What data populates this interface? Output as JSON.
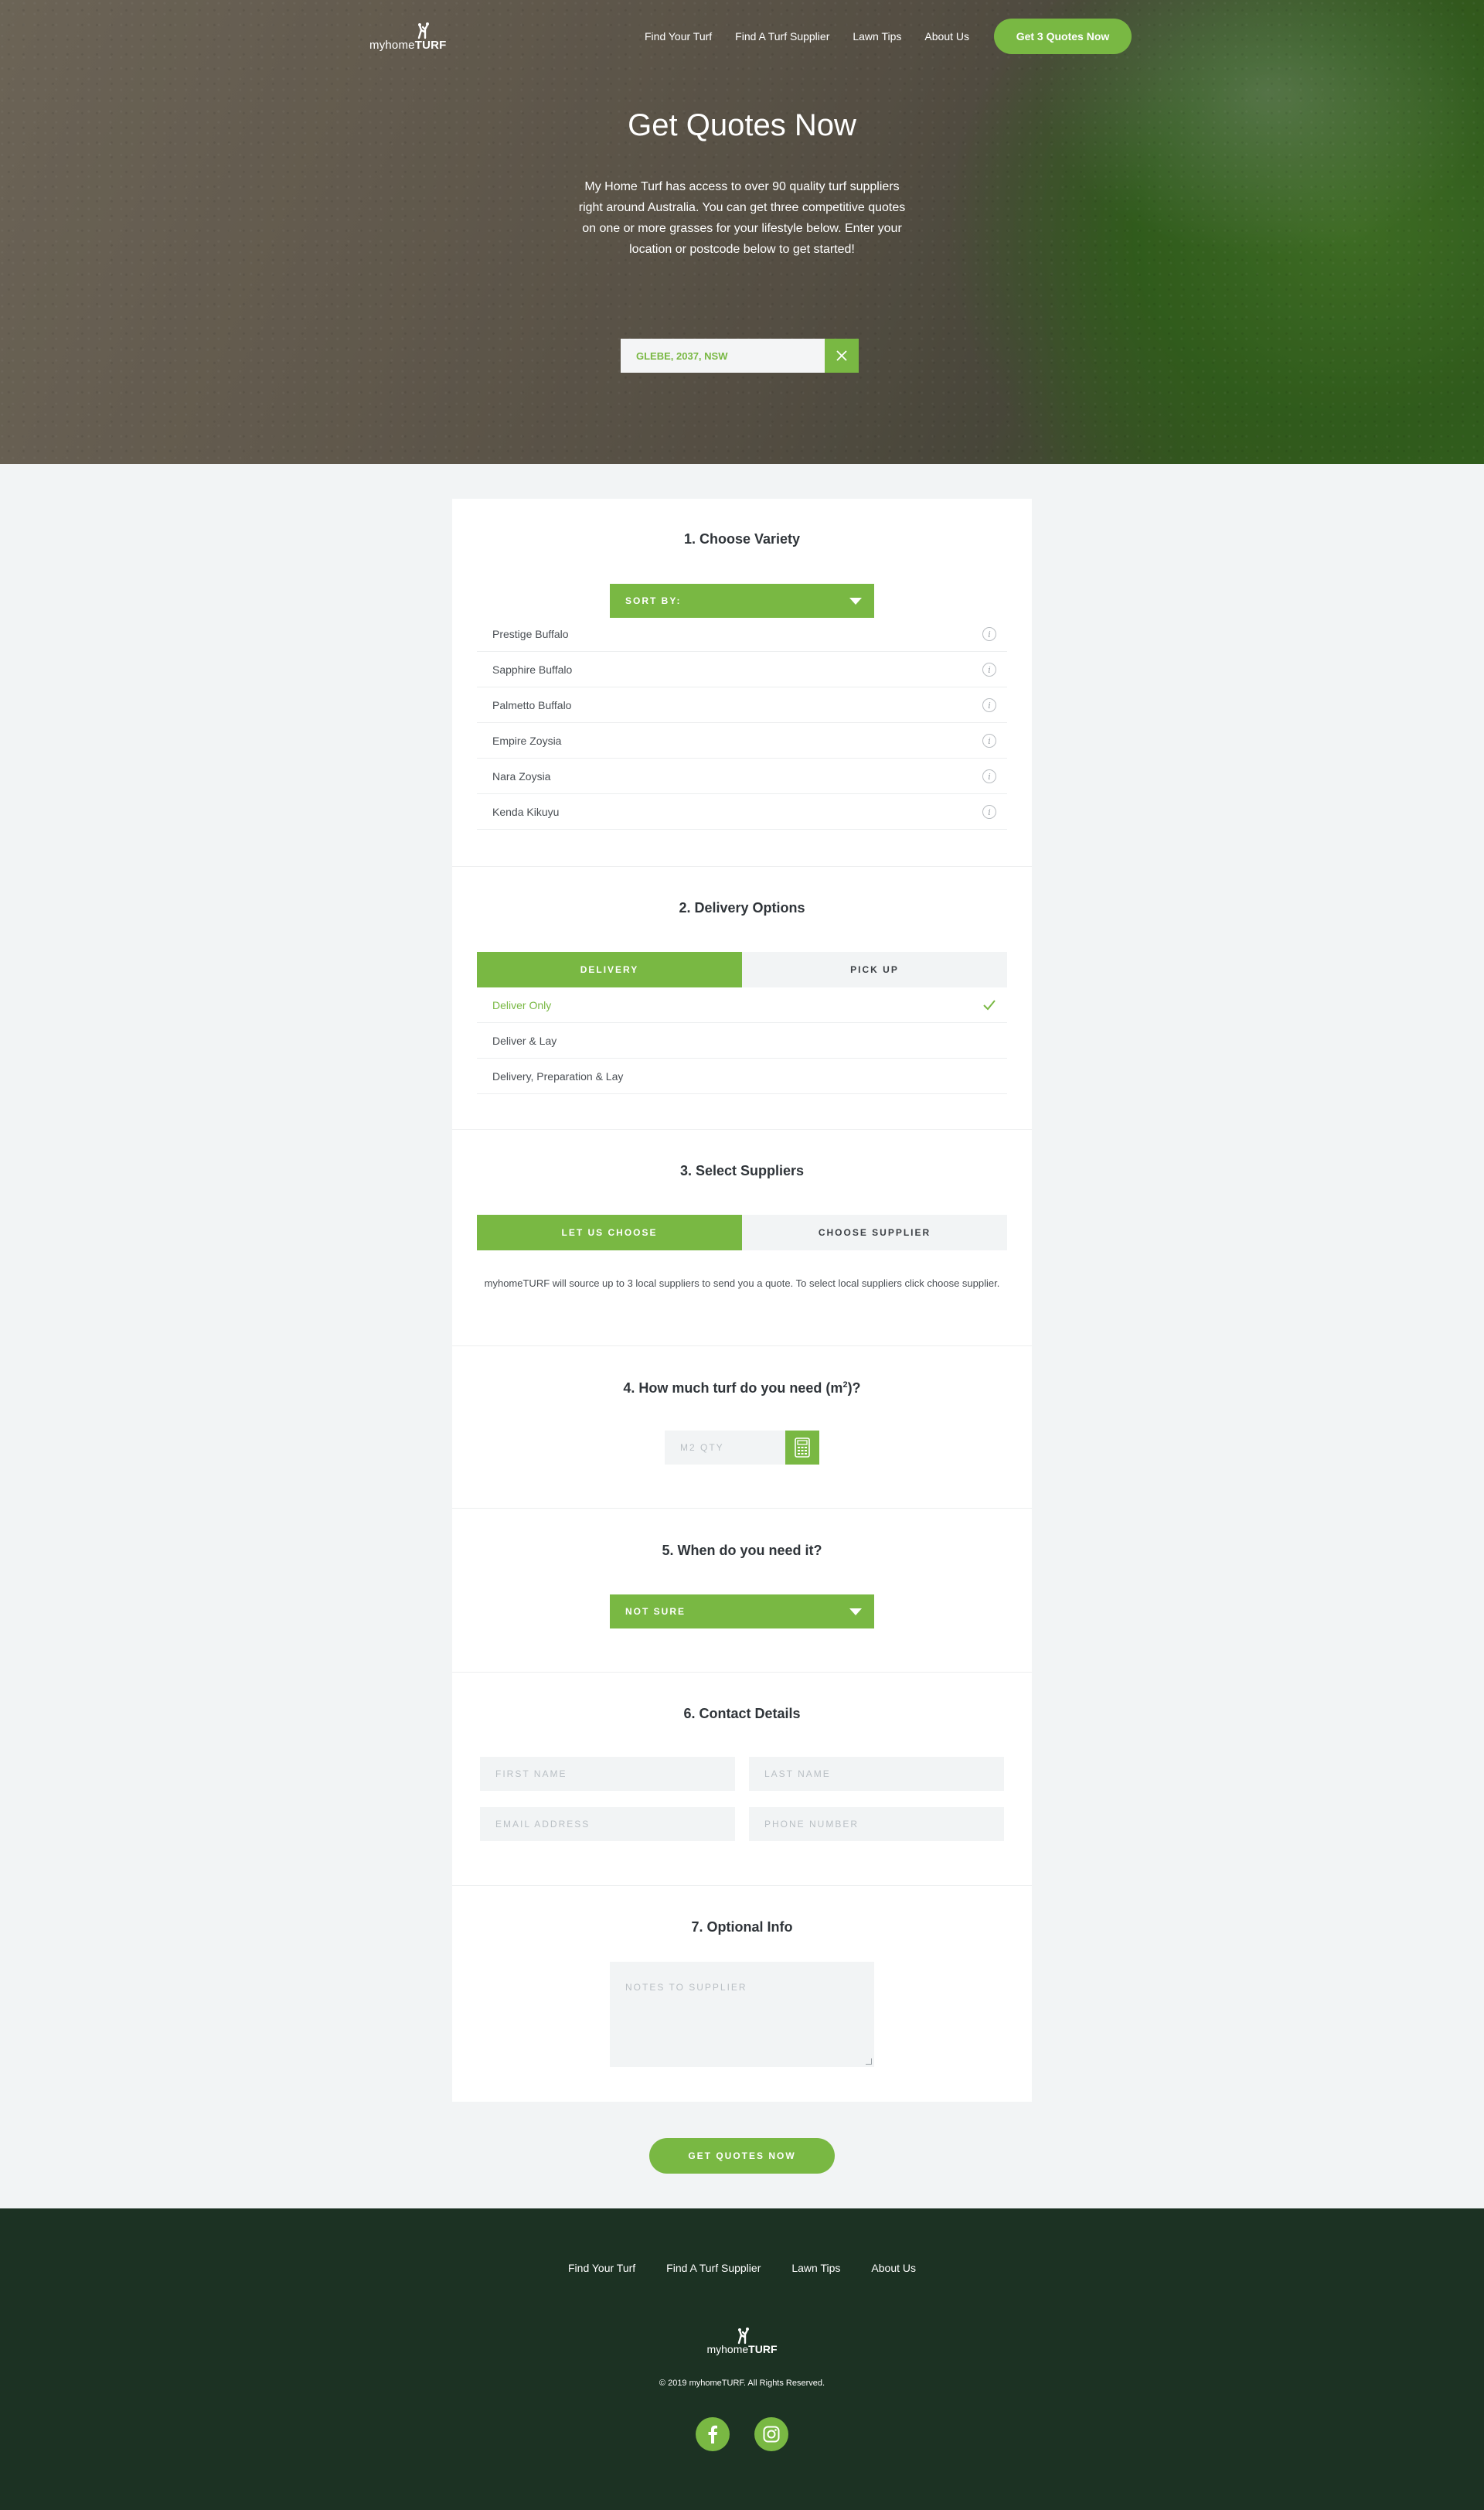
{
  "header": {
    "logo": {
      "prefix": "myhome",
      "suffix": "TURF"
    },
    "nav": [
      "Find Your Turf",
      "Find A Turf Supplier",
      "Lawn Tips",
      "About Us"
    ],
    "cta": "Get 3 Quotes Now"
  },
  "hero": {
    "title": "Get Quotes Now",
    "description": "My Home Turf has access to over 90 quality turf suppliers right around Australia. You can get three competitive quotes on one or more grasses for your lifestyle below. Enter your location or postcode below to get started!",
    "location_value": "GLEBE, 2037, NSW"
  },
  "step1": {
    "title": "1. Choose Variety",
    "sort_label": "SORT BY:",
    "varieties": [
      "Prestige Buffalo",
      "Sapphire Buffalo",
      "Palmetto Buffalo",
      "Empire Zoysia",
      "Nara Zoysia",
      "Kenda Kikuyu"
    ]
  },
  "step2": {
    "title": "2. Delivery Options",
    "tabs": [
      "DELIVERY",
      "PICK UP"
    ],
    "options": [
      "Deliver Only",
      "Deliver & Lay",
      "Delivery, Preparation & Lay"
    ],
    "selected_option": "Deliver Only"
  },
  "step3": {
    "title": "3. Select Suppliers",
    "tabs": [
      "LET US CHOOSE",
      "CHOOSE SUPPLIER"
    ],
    "note": "myhomeTURF will source up to 3 local suppliers to send you a quote. To select local suppliers click choose supplier."
  },
  "step4": {
    "title_before": "4. How much turf do you need (m",
    "title_sup": "2",
    "title_after": ")?",
    "qty_placeholder": "M2 QTY"
  },
  "step5": {
    "title": "5. When do you need it?",
    "selected": "NOT SURE"
  },
  "step6": {
    "title": "6. Contact Details",
    "first_name": "FIRST NAME",
    "last_name": "LAST NAME",
    "email": "EMAIL ADDRESS",
    "phone": "PHONE NUMBER"
  },
  "step7": {
    "title": "7. Optional Info",
    "notes_placeholder": "NOTES TO SUPPLIER"
  },
  "submit_label": "GET QUOTES NOW",
  "footer": {
    "links": [
      "Find Your Turf",
      "Find A Turf Supplier",
      "Lawn Tips",
      "About Us"
    ],
    "logo": {
      "prefix": "myhome",
      "suffix": "TURF"
    },
    "copyright": "© 2019 myhomeTURF. All Rights Reserved.",
    "socials": [
      "facebook-icon",
      "instagram-icon"
    ]
  },
  "colors": {
    "accent": "#79b843",
    "footer_bg": "#1c3223",
    "page_bg": "#f2f4f5"
  }
}
